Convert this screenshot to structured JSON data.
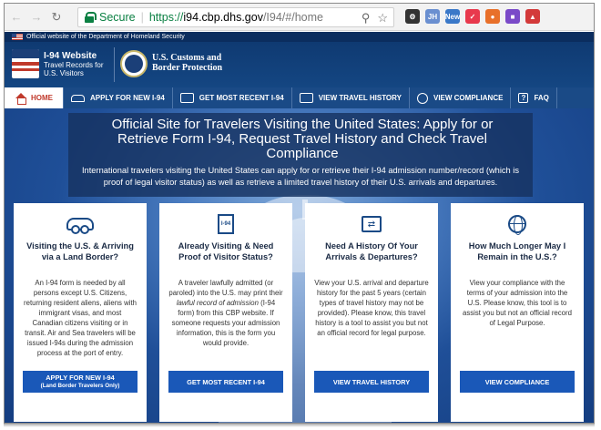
{
  "browser": {
    "secure_label": "Secure",
    "url_protocol": "https://",
    "url_host": "i94.cbp.dhs.gov",
    "url_path": "/I94/#/home",
    "extensions": [
      {
        "name": "gear-extension-icon",
        "label": "",
        "color": "#333333"
      },
      {
        "name": "jh-extension",
        "label": "JH",
        "color": "#6a8fd0"
      },
      {
        "name": "new-extension",
        "label": "New",
        "color": "#3a78c8"
      },
      {
        "name": "pocket-extension",
        "label": "",
        "color": "#e8394d"
      },
      {
        "name": "ext-orange",
        "label": "",
        "color": "#e8702a"
      },
      {
        "name": "ext-purple",
        "label": "",
        "color": "#7a4ac8"
      },
      {
        "name": "ext-red",
        "label": "",
        "color": "#d33a3a"
      }
    ]
  },
  "gov_banner": "Official website of the Department of Homeland Security",
  "header": {
    "site_name": "I-94 Website",
    "site_sub": "Travel Records for U.S. Visitors",
    "agency": "U.S. Customs and Border Protection"
  },
  "nav": [
    {
      "label": "HOME",
      "icon": "home-icon"
    },
    {
      "label": "APPLY FOR NEW I-94",
      "icon": "car-icon"
    },
    {
      "label": "GET MOST RECENT I-94",
      "icon": "document-icon"
    },
    {
      "label": "VIEW TRAVEL HISTORY",
      "icon": "swap-icon"
    },
    {
      "label": "VIEW COMPLIANCE",
      "icon": "globe-icon"
    },
    {
      "label": "FAQ",
      "icon": "help-icon"
    }
  ],
  "hero": {
    "title": "Official Site for Travelers Visiting the United States: Apply for or Retrieve Form I-94, Request Travel History and Check Travel Compliance",
    "text": "International travelers visiting the United States can apply for or retrieve their I-94 admission number/record (which is proof of legal visitor status) as well as retrieve a limited travel history of their U.S. arrivals and departures."
  },
  "cards": [
    {
      "icon": "car-icon",
      "title": "Visiting the U.S. & Arriving via a Land Border?",
      "body": "An I-94 form is needed by all persons except U.S. Citizens, returning resident aliens, aliens with immigrant visas, and most Canadian citizens visiting or in transit. Air and Sea travelers will be issued I-94s during the admission process at the port of entry.",
      "button": "APPLY FOR NEW I-94",
      "button_sub": "(Land Border Travelers Only)"
    },
    {
      "icon": "document-icon",
      "icon_text": "I-94",
      "title": "Already Visiting & Need Proof of Visitor Status?",
      "body_pre": "A traveler lawfully admitted (or paroled) into the U.S. may print their ",
      "body_ital": "lawful record of admission",
      "body_post": " (I-94 form) from this CBP website. If someone requests your admission information, this is the form you would provide.",
      "button": "GET MOST RECENT I-94"
    },
    {
      "icon": "swap-icon",
      "title": "Need A History Of Your Arrivals & Departures?",
      "body": "View your U.S. arrival and departure history for the past 5 years (certain types of travel history may not be provided). Please know, this travel history is a tool to assist you but not an official record for legal purpose.",
      "button": "VIEW TRAVEL HISTORY"
    },
    {
      "icon": "globe-icon",
      "title": "How Much Longer May I Remain in the U.S.?",
      "body": "View your compliance with the terms of your admission into the U.S. Please know, this tool is to assist you but not an official record of Legal Purpose.",
      "button": "VIEW COMPLIANCE"
    }
  ]
}
